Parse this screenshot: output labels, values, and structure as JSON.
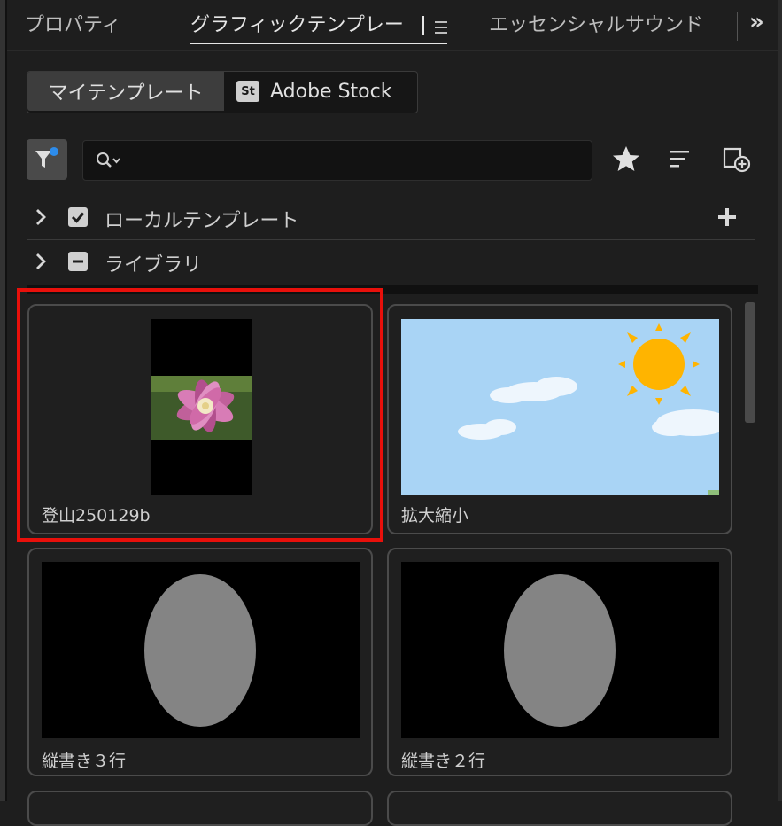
{
  "tabs": {
    "properties": "プロパティ",
    "graphic_templates": "グラフィックテンプレー",
    "essential_sound": "エッセンシャルサウンド",
    "more": "»"
  },
  "segmented": {
    "my_templates": "マイテンプレート",
    "stock_icon": "St",
    "adobe_stock": "Adobe Stock"
  },
  "tree": {
    "local_templates": "ローカルテンプレート",
    "library": "ライブラリ"
  },
  "templates": [
    {
      "label": "登山250129b"
    },
    {
      "label": "拡大縮小"
    },
    {
      "label": "縦書き３行"
    },
    {
      "label": "縦書き２行"
    }
  ],
  "colors": {
    "highlight": "#e8100b",
    "filter_dot": "#2d8ceb",
    "sky": "#a9d4f5",
    "sun": "#ffb400"
  }
}
